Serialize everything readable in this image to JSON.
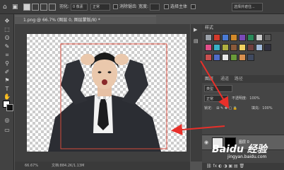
{
  "document": {
    "tab_title": "1.png @ 66.7% (图层 0, 图层蒙版/8) *",
    "zoom": "66.67%",
    "status": "文档:884.2K/1.13M"
  },
  "options": {
    "feather_label": "羽化:",
    "feather_value": "0 像素",
    "style_value": "正常",
    "antialias_label": "消除锯齿",
    "width_label": "宽度:",
    "subject_button": "选择主体",
    "select_mask_button": "选择并遮住..."
  },
  "panels": {
    "styles_title": "样式",
    "layers_title": "图层",
    "channels_title": "通道",
    "paths_title": "路径",
    "filter_label": "类型",
    "blend_mode": "正常",
    "opacity_label": "不透明度:",
    "opacity_value": "100%",
    "lock_label": "锁定:",
    "fill_label": "填充:",
    "fill_value": "100%",
    "layer_name": "图层 0"
  },
  "watermark": {
    "brand": "Baidu 经验",
    "url": "jingyan.baidu.com"
  },
  "colors": {
    "arrow": "#e8302a",
    "selection": "#d64a3b",
    "accent": "#2d7de5"
  }
}
